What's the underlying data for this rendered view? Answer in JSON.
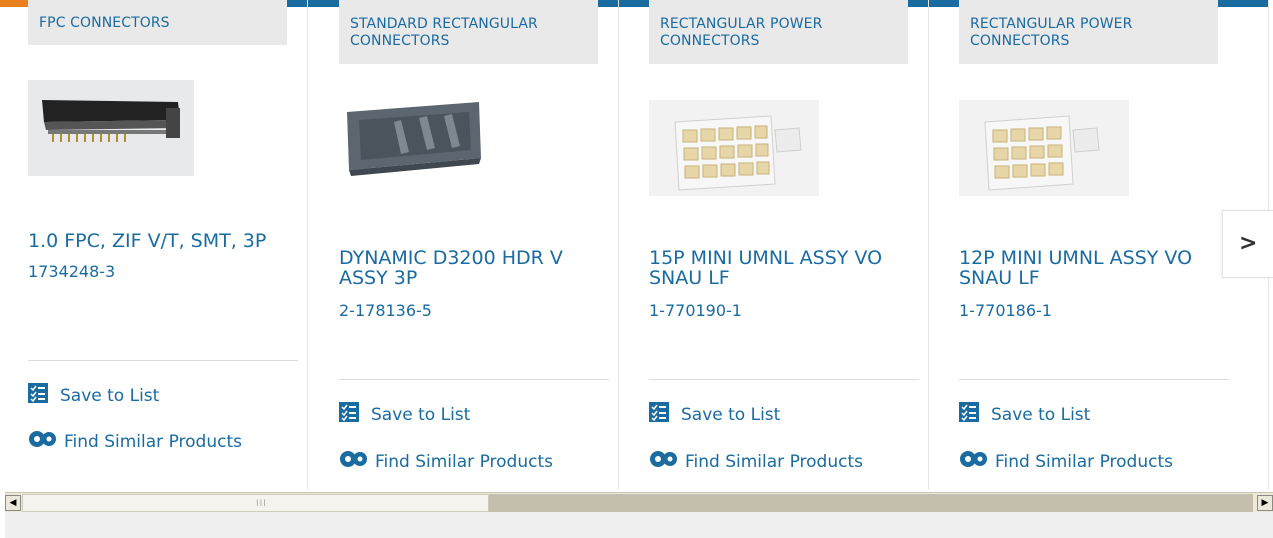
{
  "carousel": {
    "cards": [
      {
        "category": "FPC CONNECTORS",
        "title": "1.0 FPC, ZIF V/T, SMT, 3P",
        "part_number": "1734248-3",
        "save_label": "Save to List",
        "similar_label": "Find Similar Products"
      },
      {
        "category": "STANDARD RECTANGULAR CONNECTORS",
        "title": "DYNAMIC D3200 HDR V ASSY 3P",
        "part_number": "2-178136-5",
        "save_label": "Save to List",
        "similar_label": "Find Similar Products"
      },
      {
        "category": "RECTANGULAR POWER CONNECTORS",
        "title": "15P MINI UMNL ASSY VO SNAU LF",
        "part_number": "1-770190-1",
        "save_label": "Save to List",
        "similar_label": "Find Similar Products"
      },
      {
        "category": "RECTANGULAR POWER CONNECTORS",
        "title": "12P MINI UMNL ASSY VO SNAU LF",
        "part_number": "1-770186-1",
        "save_label": "Save to List",
        "similar_label": "Find Similar Products"
      }
    ],
    "next_icon": "chevron-right-icon",
    "next_label": ">"
  },
  "colors": {
    "brand_blue": "#1a6ba0",
    "accent_orange": "#e8801e",
    "category_bg": "#e9e9e9"
  },
  "scrollbar": {
    "left_arrow": "◀",
    "right_arrow": "▶",
    "grip": "III"
  }
}
